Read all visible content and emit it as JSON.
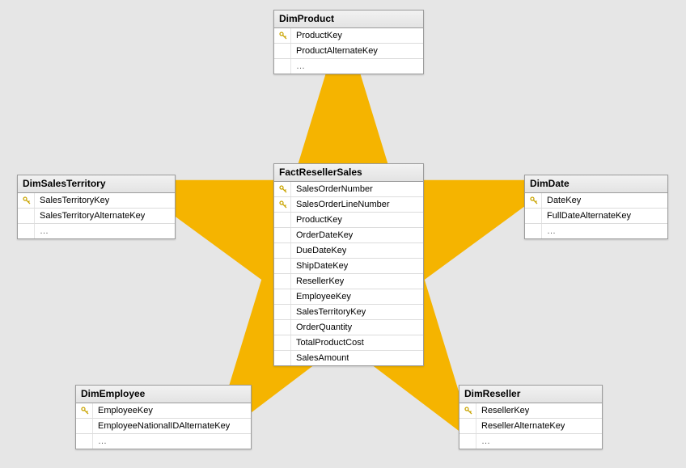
{
  "tables": {
    "dimProduct": {
      "title": "DimProduct",
      "rows": [
        {
          "key": true,
          "label": "ProductKey"
        },
        {
          "key": false,
          "label": "ProductAlternateKey"
        }
      ]
    },
    "dimSalesTerritory": {
      "title": "DimSalesTerritory",
      "rows": [
        {
          "key": true,
          "label": "SalesTerritoryKey"
        },
        {
          "key": false,
          "label": "SalesTerritoryAlternateKey"
        }
      ]
    },
    "dimDate": {
      "title": "DimDate",
      "rows": [
        {
          "key": true,
          "label": "DateKey"
        },
        {
          "key": false,
          "label": "FullDateAlternateKey"
        }
      ]
    },
    "factResellerSales": {
      "title": "FactResellerSales",
      "rows": [
        {
          "key": true,
          "label": "SalesOrderNumber"
        },
        {
          "key": true,
          "label": "SalesOrderLineNumber"
        },
        {
          "key": false,
          "label": "ProductKey"
        },
        {
          "key": false,
          "label": "OrderDateKey"
        },
        {
          "key": false,
          "label": "DueDateKey"
        },
        {
          "key": false,
          "label": "ShipDateKey"
        },
        {
          "key": false,
          "label": "ResellerKey"
        },
        {
          "key": false,
          "label": "EmployeeKey"
        },
        {
          "key": false,
          "label": "SalesTerritoryKey"
        },
        {
          "key": false,
          "label": "OrderQuantity"
        },
        {
          "key": false,
          "label": "TotalProductCost"
        },
        {
          "key": false,
          "label": "SalesAmount"
        }
      ]
    },
    "dimEmployee": {
      "title": "DimEmployee",
      "rows": [
        {
          "key": true,
          "label": "EmployeeKey"
        },
        {
          "key": false,
          "label": "EmployeeNationalIDAlternateKey"
        }
      ]
    },
    "dimReseller": {
      "title": "DimReseller",
      "rows": [
        {
          "key": true,
          "label": "ResellerKey"
        },
        {
          "key": false,
          "label": "ResellerAlternateKey"
        }
      ]
    }
  },
  "ellipsis": "…"
}
